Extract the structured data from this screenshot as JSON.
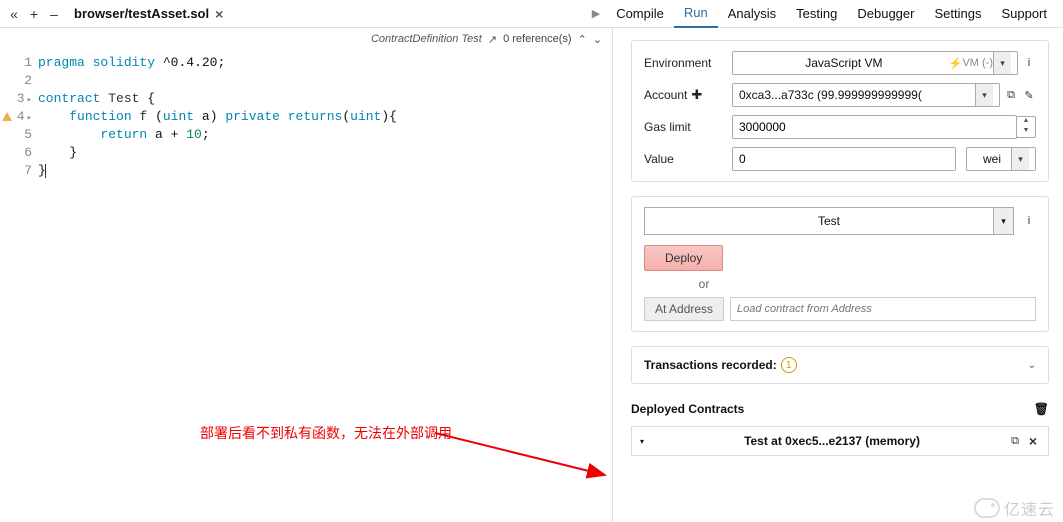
{
  "topbar": {
    "file_tab": "browser/testAsset.sol",
    "nav": [
      "Compile",
      "Run",
      "Analysis",
      "Testing",
      "Debugger",
      "Settings",
      "Support"
    ],
    "active_nav_index": 1
  },
  "editor_header": {
    "context": "ContractDefinition Test",
    "refs": "0 reference(s)"
  },
  "code_lines": [
    {
      "n": "1",
      "t": "pragma solidity ^0.4.20;"
    },
    {
      "n": "2",
      "t": ""
    },
    {
      "n": "3",
      "t": "contract Test {",
      "arrow": true
    },
    {
      "n": "4",
      "t": "    function f (uint a) private returns(uint){",
      "arrow": true,
      "warn": true
    },
    {
      "n": "5",
      "t": "        return a + 10;"
    },
    {
      "n": "6",
      "t": "    }"
    },
    {
      "n": "7",
      "t": "}"
    }
  ],
  "annotation": "部署后看不到私有函数，无法在外部调用",
  "run": {
    "env_label": "Environment",
    "env_value": "JavaScript VM",
    "env_suffix": "VM (-)",
    "account_label": "Account",
    "account_value": "0xca3...a733c (99.999999999999(",
    "gaslimit_label": "Gas limit",
    "gaslimit_value": "3000000",
    "value_label": "Value",
    "value_value": "0",
    "value_unit": "wei",
    "contract_selected": "Test",
    "deploy_label": "Deploy",
    "or_label": "or",
    "at_address_label": "At Address",
    "at_address_placeholder": "Load contract from Address"
  },
  "tx_recorded": {
    "label": "Transactions recorded:",
    "count": "1"
  },
  "deployed": {
    "header": "Deployed Contracts",
    "instance": "Test at 0xec5...e2137 (memory)"
  },
  "watermark": "亿速云"
}
